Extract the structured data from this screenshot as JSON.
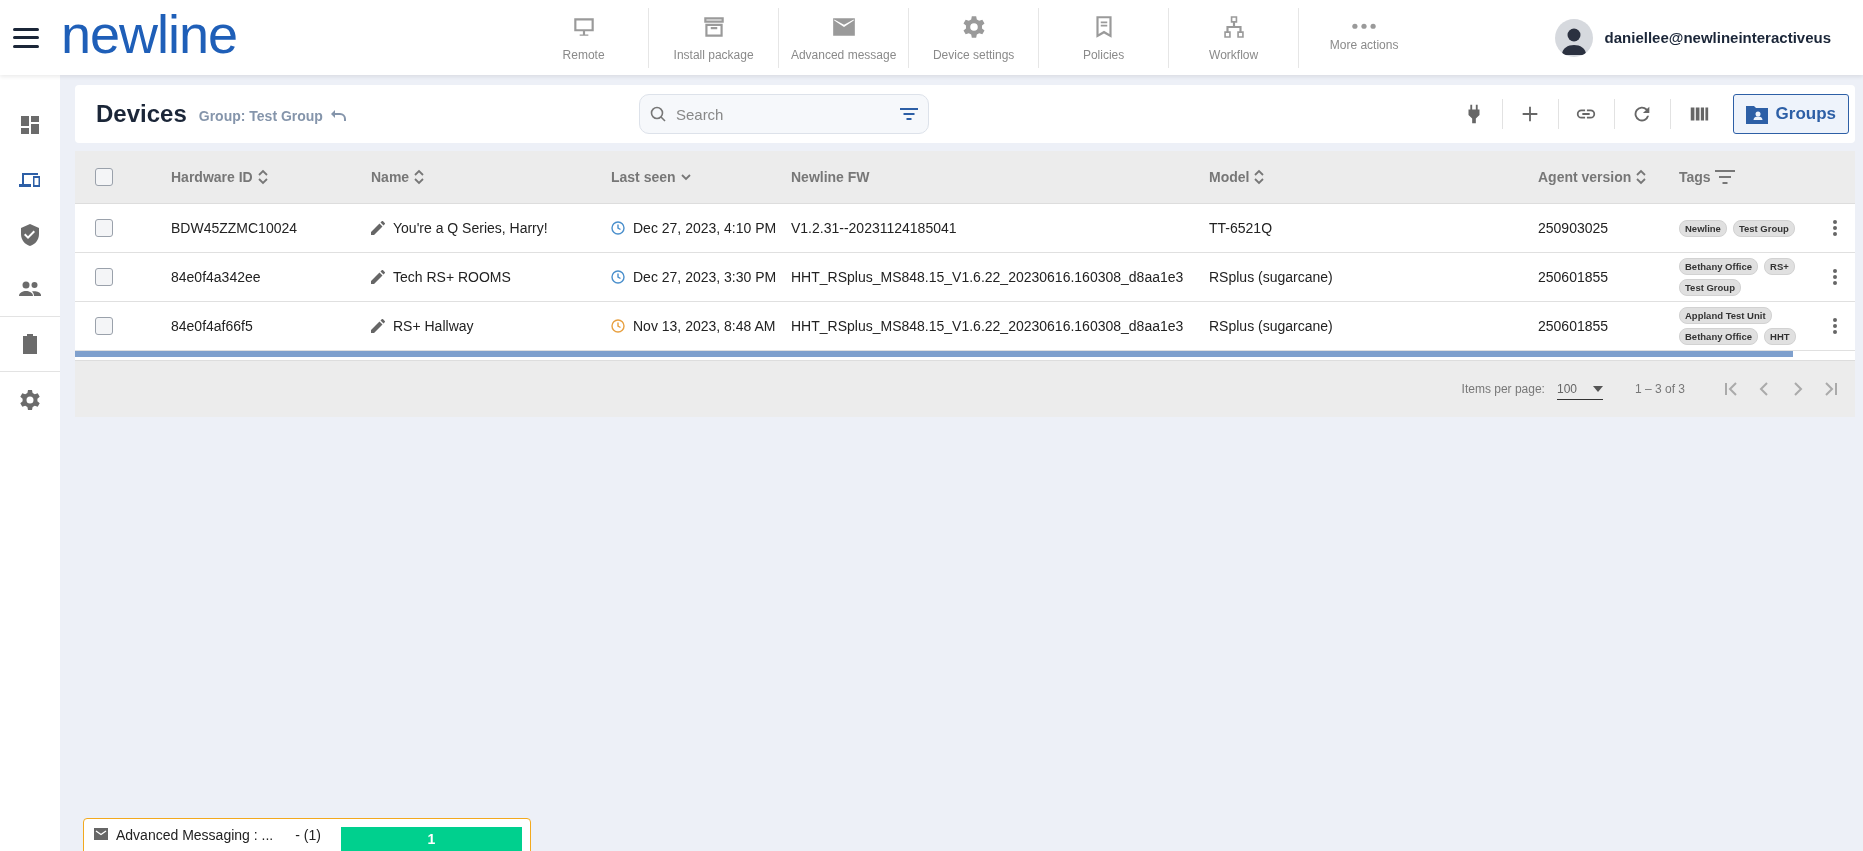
{
  "brand": "newline",
  "actions": [
    {
      "kind": "monitor",
      "label": "Remote"
    },
    {
      "kind": "archive",
      "label": "Install package"
    },
    {
      "kind": "mail",
      "label": "Advanced message"
    },
    {
      "kind": "gear",
      "label": "Device settings"
    },
    {
      "kind": "bookmark",
      "label": "Policies"
    },
    {
      "kind": "flow",
      "label": "Workflow"
    },
    {
      "kind": "dots",
      "label": "More actions"
    }
  ],
  "user": {
    "email": "daniellee@newlineinteractiveus"
  },
  "sidebar": {
    "items": [
      {
        "kind": "dashboard",
        "selected": false
      },
      {
        "kind": "devices",
        "selected": true
      },
      {
        "kind": "shield",
        "selected": false
      },
      {
        "kind": "people",
        "selected": false
      },
      {
        "kind": "clipboard",
        "selected": false
      },
      {
        "kind": "gear",
        "selected": false
      }
    ]
  },
  "page": {
    "title": "Devices",
    "group": "Group: Test Group"
  },
  "search": {
    "placeholder": "Search"
  },
  "header_tools": [
    {
      "kind": "plug"
    },
    {
      "kind": "plus"
    },
    {
      "kind": "link"
    },
    {
      "kind": "refresh"
    },
    {
      "kind": "columns"
    }
  ],
  "groups_button": "Groups",
  "table": {
    "select_all": {
      "checked": false
    },
    "columns": [
      {
        "label": "Hardware ID",
        "kind": "sortable"
      },
      {
        "label": "Name",
        "kind": "sortable"
      },
      {
        "label": "Last seen",
        "kind": "sorted"
      },
      {
        "label": "Newline FW",
        "kind": "plain"
      },
      {
        "label": "Model",
        "kind": "sortable"
      },
      {
        "label": "Agent version",
        "kind": "sortable"
      },
      {
        "label": "Tags",
        "kind": "filterable"
      }
    ],
    "rows": [
      {
        "checked": false,
        "hardware_id": "BDW45ZZMC10024",
        "name": "You're a Q Series, Harry!",
        "last_seen": "Dec 27, 2023, 4:10 PM",
        "color": "#4a8fcc",
        "fw": "V1.2.31--20231124185041",
        "model": "TT-6521Q",
        "agent": "250903025",
        "tags": [
          "Newline",
          "Test Group"
        ]
      },
      {
        "checked": false,
        "hardware_id": "84e0f4a342ee",
        "name": "Tech RS+ ROOMS",
        "last_seen": "Dec 27, 2023, 3:30 PM",
        "color": "#4a8fcc",
        "fw": "HHT_RSplus_MS848.15_V1.6.22_20230616.160308_d8aa1e3",
        "model": "RSplus (sugarcane)",
        "agent": "250601855",
        "tags": [
          "Bethany Office",
          "RS+",
          "Test Group"
        ]
      },
      {
        "checked": false,
        "hardware_id": "84e0f4af66f5",
        "name": "RS+ Hallway",
        "last_seen": "Nov 13, 2023, 8:48 AM",
        "color": "#e8a040",
        "fw": "HHT_RSplus_MS848.15_V1.6.22_20230616.160308_d8aa1e3",
        "model": "RSplus (sugarcane)",
        "agent": "250601855",
        "tags": [
          "Appland Test Unit",
          "Bethany Office",
          "HHT"
        ]
      }
    ]
  },
  "paginator": {
    "label": "Items per page:",
    "page_size": "100",
    "range": "1 – 3 of 3"
  },
  "notification": {
    "title": "Advanced Messaging : ...",
    "count": "- (1)",
    "level": 1,
    "bar_text": "1"
  }
}
